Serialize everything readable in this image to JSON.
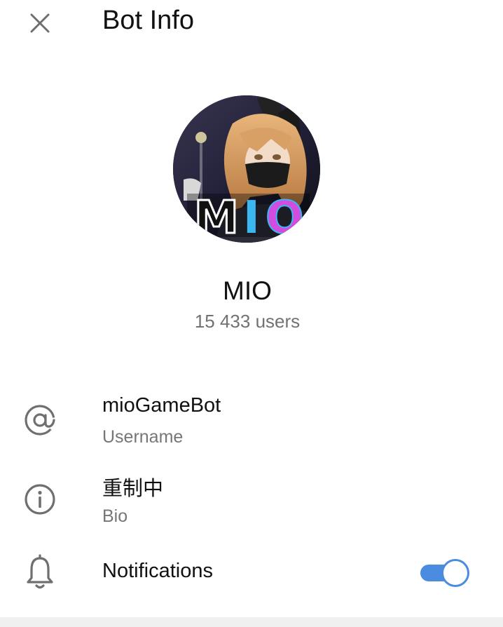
{
  "header": {
    "title": "Bot Info",
    "close_icon": "close-icon"
  },
  "profile": {
    "name": "MIO",
    "users": "15 433 users",
    "avatar_text": "MIO"
  },
  "rows": {
    "username": {
      "icon": "at-icon",
      "value": "mioGameBot",
      "label": "Username"
    },
    "bio": {
      "icon": "info-icon",
      "value": "重制中",
      "label": "Bio"
    },
    "notifications": {
      "icon": "bell-icon",
      "label": "Notifications",
      "enabled": true
    }
  },
  "colors": {
    "accent": "#4b8be0",
    "secondary_text": "#767676",
    "icon": "#6f6f6f"
  }
}
